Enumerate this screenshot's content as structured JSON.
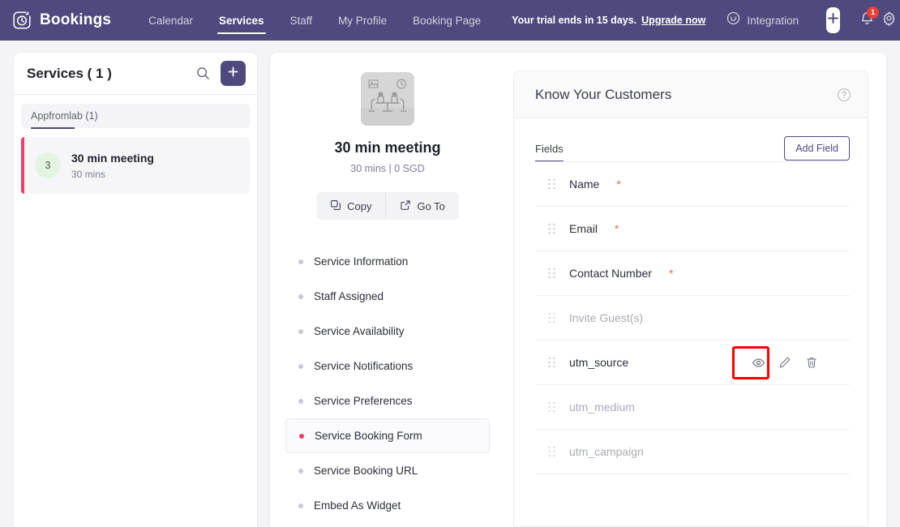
{
  "topbar": {
    "brand": "Bookings",
    "logo_icon": "clock-logo-icon",
    "nav": [
      {
        "label": "Calendar",
        "active": false
      },
      {
        "label": "Services",
        "active": true
      },
      {
        "label": "Staff",
        "active": false
      },
      {
        "label": "My Profile",
        "active": false
      },
      {
        "label": "Booking Page",
        "active": false
      }
    ],
    "trial_text": "Your trial ends in 15 days.",
    "trial_link": "Upgrade now",
    "integration_label": "Integration",
    "integration_icon": "integration-icon",
    "plus_icon": "plus-icon",
    "bell_icon": "bell-icon",
    "notification_count": "1",
    "gear_icon": "gear-icon",
    "bg_color": "#4e4a7d"
  },
  "sidebar": {
    "title": "Services ( 1 )",
    "search_icon": "search-icon",
    "add_icon": "plus-icon",
    "group_tab": "Appfromlab (1)",
    "services": [
      {
        "badge": "3",
        "name": "30 min meeting",
        "duration": "30 mins",
        "selected": true
      }
    ],
    "accent_color": "#ef3e62"
  },
  "service": {
    "thumbnail_icon": "meeting-table-thumbnail",
    "image_icon": "image-icon",
    "clock_icon": "clock-icon",
    "title": "30 min meeting",
    "subtitle": "30 mins | 0 SGD",
    "actions": [
      {
        "label": "Copy",
        "icon": "copy-icon"
      },
      {
        "label": "Go To",
        "icon": "external-link-icon"
      }
    ],
    "menu": [
      {
        "label": "Service Information",
        "active": false
      },
      {
        "label": "Staff Assigned",
        "active": false
      },
      {
        "label": "Service Availability",
        "active": false
      },
      {
        "label": "Service Notifications",
        "active": false
      },
      {
        "label": "Service Preferences",
        "active": false
      },
      {
        "label": "Service Booking Form",
        "active": true
      },
      {
        "label": "Service Booking URL",
        "active": false
      },
      {
        "label": "Embed As Widget",
        "active": false
      }
    ]
  },
  "panel": {
    "title": "Know Your Customers",
    "help_icon": "help-circle-icon",
    "tab_label": "Fields",
    "add_field_label": "Add Field",
    "fields": [
      {
        "label": "Name",
        "required": true,
        "muted": false,
        "actions": false
      },
      {
        "label": "Email",
        "required": true,
        "muted": false,
        "actions": false
      },
      {
        "label": "Contact Number",
        "required": true,
        "muted": false,
        "actions": false
      },
      {
        "label": "Invite Guest(s)",
        "required": false,
        "muted": true,
        "actions": false
      },
      {
        "label": "utm_source",
        "required": false,
        "muted": false,
        "actions": true,
        "action_icons": [
          "eye-icon",
          "edit-pencil-icon",
          "trash-icon"
        ],
        "highlighted_action": "eye-icon"
      },
      {
        "label": "utm_medium",
        "required": false,
        "muted": true,
        "actions": false
      },
      {
        "label": "utm_campaign",
        "required": false,
        "muted": true,
        "actions": false
      }
    ],
    "highlight_color": "#ff0000"
  }
}
